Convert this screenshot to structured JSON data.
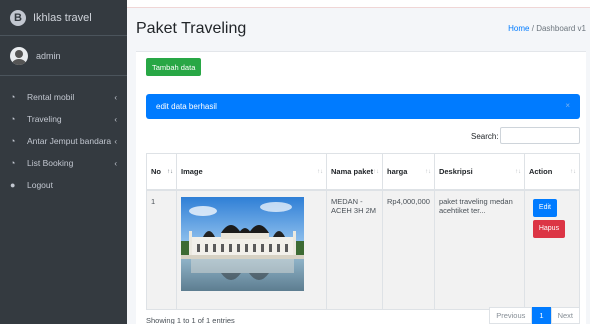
{
  "brand": {
    "logo_letter": "B",
    "name": "Ikhlas travel"
  },
  "user": {
    "name": "admin"
  },
  "sidebar": {
    "items": [
      {
        "label": "Rental mobil",
        "icon": "tachometer-icon",
        "has_chevron": true
      },
      {
        "label": "Traveling",
        "icon": "tachometer-icon",
        "has_chevron": true
      },
      {
        "label": "Antar Jemput bandara",
        "icon": "tachometer-icon",
        "has_chevron": true
      },
      {
        "label": "List Booking",
        "icon": "tachometer-icon",
        "has_chevron": true
      },
      {
        "label": "Logout",
        "icon": "user-icon",
        "has_chevron": false
      }
    ]
  },
  "page": {
    "title": "Paket Traveling",
    "breadcrumb": {
      "home": "Home",
      "separator": "/",
      "current": "Dashboard v1"
    }
  },
  "toolbar": {
    "add_label": "Tambah data"
  },
  "alert": {
    "message": "edit data berhasil",
    "close": "×"
  },
  "search": {
    "label": "Search:",
    "value": ""
  },
  "table": {
    "headers": [
      "No",
      "Image",
      "Nama paket",
      "harga",
      "Deskripsi",
      "Action"
    ],
    "rows": [
      {
        "no": "1",
        "nama_paket": "MEDAN - ACEH 3H 2M",
        "harga": "Rp4,000,000",
        "deskripsi": "paket traveling medan acehtiket ter...",
        "edit": "Edit",
        "hapus": "Hapus"
      }
    ]
  },
  "footer": {
    "info": "Showing 1 to 1 of 1 entries"
  },
  "pagination": {
    "previous": "Previous",
    "current": "1",
    "next": "Next"
  },
  "colors": {
    "sidebar": "#343a40",
    "primary": "#007bff",
    "success": "#28a745",
    "danger": "#dc3545"
  }
}
